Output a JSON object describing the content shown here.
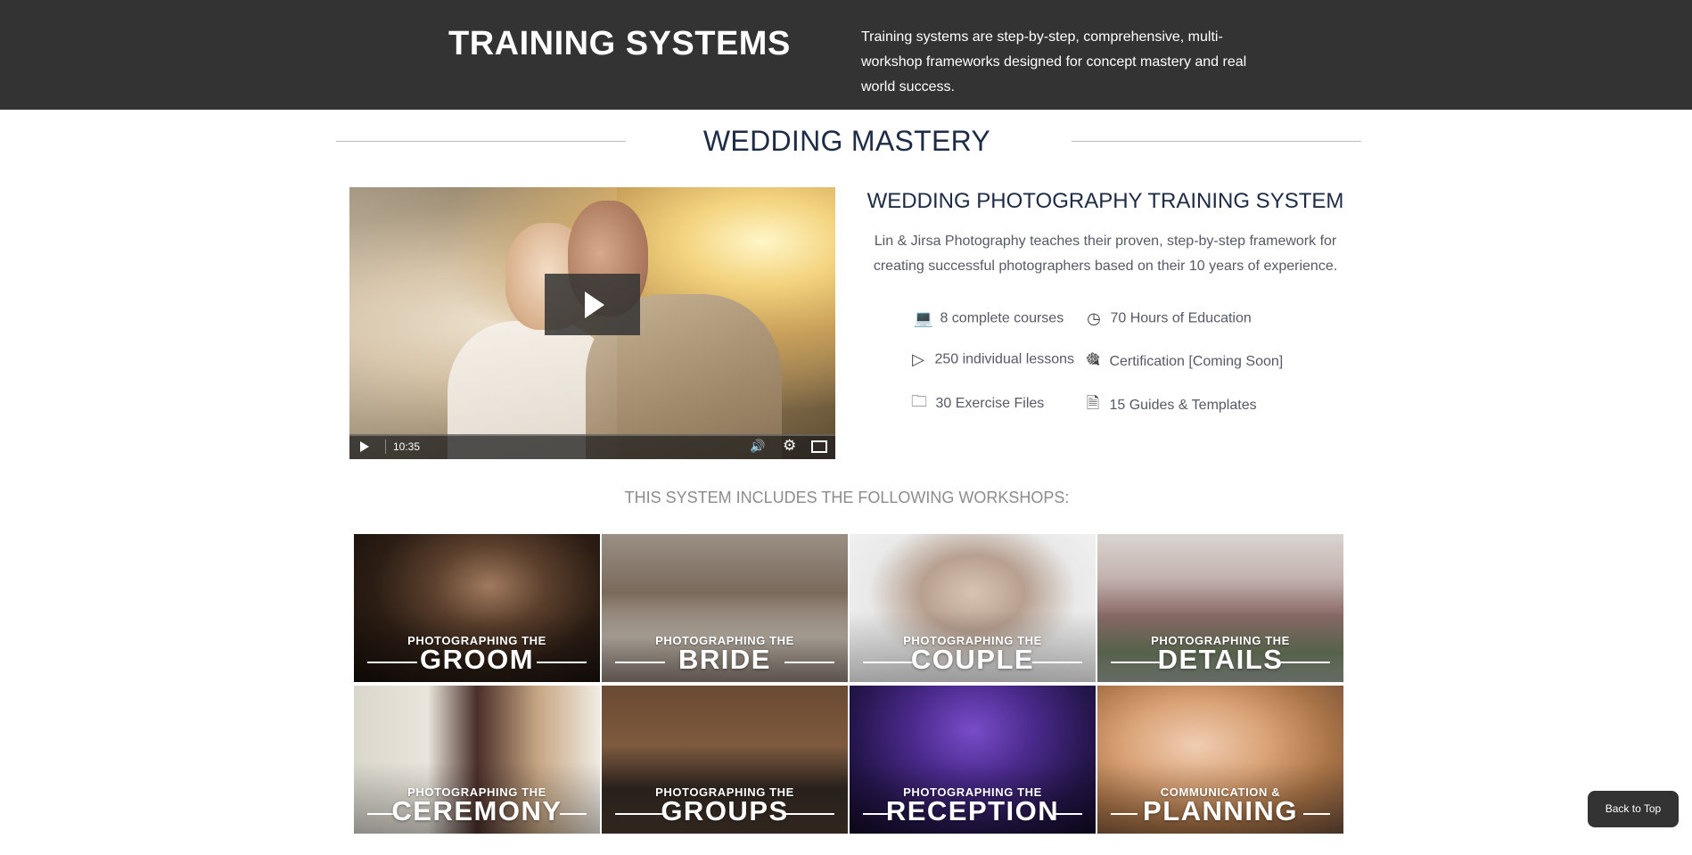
{
  "header": {
    "title": "TRAINING SYSTEMS",
    "description": "Training systems are step-by-step, comprehensive, multi-workshop frameworks designed for concept mastery and real world success."
  },
  "section": {
    "title": "WEDDING MASTERY"
  },
  "video": {
    "duration": "10:35"
  },
  "system": {
    "title": "WEDDING PHOTOGRAPHY TRAINING SYSTEM",
    "description": "Lin & Jirsa Photography teaches their proven, step-by-step framework for creating successful photographers based on their 10 years of experience.",
    "features": [
      {
        "icon": "laptop-icon",
        "text": "8 complete courses"
      },
      {
        "icon": "clock-icon",
        "text": "70 Hours of Education"
      },
      {
        "icon": "play-circle-icon",
        "text": "250 individual lessons"
      },
      {
        "icon": "award-icon",
        "text": "Certification [Coming Soon]"
      },
      {
        "icon": "folder-icon",
        "text": "30 Exercise Files"
      },
      {
        "icon": "document-icon",
        "text": "15 Guides & Templates"
      }
    ]
  },
  "workshops": {
    "heading": "THIS SYSTEM INCLUDES THE FOLLOWING WORKSHOPS:",
    "items": [
      {
        "top": "PHOTOGRAPHING THE",
        "name": "GROOM"
      },
      {
        "top": "PHOTOGRAPHING THE",
        "name": "BRIDE"
      },
      {
        "top": "PHOTOGRAPHING THE",
        "name": "COUPLE"
      },
      {
        "top": "PHOTOGRAPHING THE",
        "name": "DETAILS"
      },
      {
        "top": "PHOTOGRAPHING THE",
        "name": "CEREMONY"
      },
      {
        "top": "PHOTOGRAPHING THE",
        "name": "GROUPS"
      },
      {
        "top": "PHOTOGRAPHING THE",
        "name": "RECEPTION"
      },
      {
        "top": "COMMUNICATION &",
        "name": "PLANNING"
      }
    ]
  },
  "back_to_top": "Back to Top",
  "colors": {
    "header_bg": "#333333",
    "navy": "#1d2b44",
    "body_text": "#555a66"
  }
}
